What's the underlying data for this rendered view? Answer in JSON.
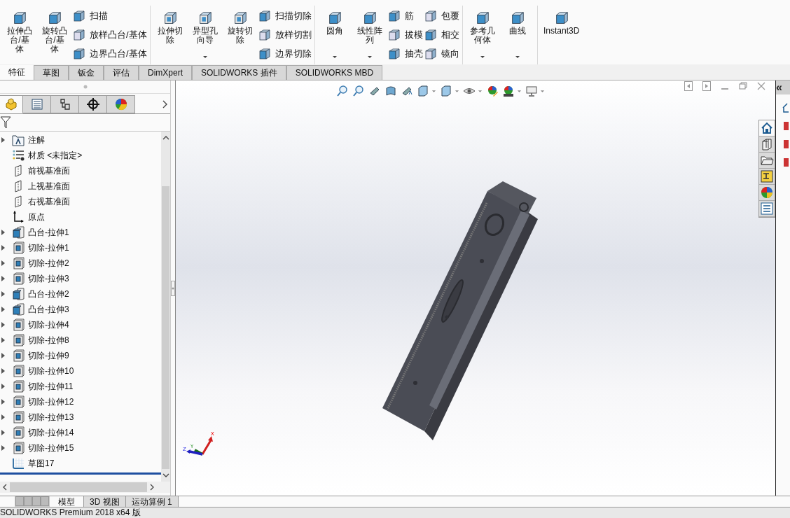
{
  "ribbon": {
    "groups": [
      {
        "large": [
          {
            "label": "拉伸凸台/基体",
            "dropdown": false
          },
          {
            "label": "旋转凸台/基体",
            "dropdown": false
          }
        ],
        "columns": [
          [
            "扫描",
            "放样凸台/基体",
            "边界凸台/基体"
          ]
        ]
      },
      {
        "large": [
          {
            "label": "拉伸切除",
            "dropdown": false
          },
          {
            "label": "异型孔向导",
            "dropdown": true
          },
          {
            "label": "旋转切除",
            "dropdown": false
          }
        ],
        "columns": [
          [
            "扫描切除",
            "放样切割",
            "边界切除"
          ]
        ]
      },
      {
        "large": [
          {
            "label": "圆角",
            "dropdown": true
          },
          {
            "label": "线性阵列",
            "dropdown": true
          }
        ],
        "columns": [
          [
            "筋",
            "拔模",
            "抽壳"
          ],
          [
            "包覆",
            "相交",
            "镜向"
          ]
        ]
      },
      {
        "large": [
          {
            "label": "参考几何体",
            "dropdown": true
          },
          {
            "label": "曲线",
            "dropdown": true
          }
        ]
      },
      {
        "large": [
          {
            "label": "Instant3D",
            "dropdown": false
          }
        ]
      }
    ]
  },
  "tabs": [
    {
      "label": "特征",
      "selected": true
    },
    {
      "label": "草图",
      "selected": false
    },
    {
      "label": "钣金",
      "selected": false
    },
    {
      "label": "评估",
      "selected": false
    },
    {
      "label": "DimXpert",
      "selected": false
    },
    {
      "label": "SOLIDWORKS 插件",
      "selected": false
    },
    {
      "label": "SOLIDWORKS MBD",
      "selected": false
    }
  ],
  "manager_tabs": [
    {
      "selected": true
    },
    {
      "selected": false
    },
    {
      "selected": false
    },
    {
      "selected": false
    },
    {
      "selected": false
    }
  ],
  "tree": [
    {
      "kind": "annotations",
      "label": "注解",
      "expandable": true
    },
    {
      "kind": "material",
      "label": "材质 <未指定>",
      "expandable": false
    },
    {
      "kind": "plane",
      "label": "前视基准面",
      "expandable": false
    },
    {
      "kind": "plane",
      "label": "上视基准面",
      "expandable": false
    },
    {
      "kind": "plane",
      "label": "右视基准面",
      "expandable": false
    },
    {
      "kind": "origin",
      "label": "原点",
      "expandable": false
    },
    {
      "kind": "boss",
      "label": "凸台-拉伸1",
      "expandable": true
    },
    {
      "kind": "cut",
      "label": "切除-拉伸1",
      "expandable": true
    },
    {
      "kind": "cut",
      "label": "切除-拉伸2",
      "expandable": true
    },
    {
      "kind": "cut",
      "label": "切除-拉伸3",
      "expandable": true
    },
    {
      "kind": "boss",
      "label": "凸台-拉伸2",
      "expandable": true
    },
    {
      "kind": "boss",
      "label": "凸台-拉伸3",
      "expandable": true
    },
    {
      "kind": "cut",
      "label": "切除-拉伸4",
      "expandable": true
    },
    {
      "kind": "cut",
      "label": "切除-拉伸8",
      "expandable": true
    },
    {
      "kind": "cut",
      "label": "切除-拉伸9",
      "expandable": true
    },
    {
      "kind": "cut",
      "label": "切除-拉伸10",
      "expandable": true
    },
    {
      "kind": "cut",
      "label": "切除-拉伸11",
      "expandable": true
    },
    {
      "kind": "cut",
      "label": "切除-拉伸12",
      "expandable": true
    },
    {
      "kind": "cut",
      "label": "切除-拉伸13",
      "expandable": true
    },
    {
      "kind": "cut",
      "label": "切除-拉伸14",
      "expandable": true
    },
    {
      "kind": "cut",
      "label": "切除-拉伸15",
      "expandable": true
    },
    {
      "kind": "sketch",
      "label": "草图17",
      "expandable": false
    }
  ],
  "triad": {
    "labels": [
      "X",
      "Y",
      "Z"
    ]
  },
  "bottom_tabs": [
    {
      "label": "模型",
      "selected": true
    },
    {
      "label": "3D 视图",
      "selected": false
    },
    {
      "label": "运动算例 1",
      "selected": false
    }
  ],
  "task_pane": {
    "collapse": "«"
  },
  "status_bar": {
    "text": "SOLIDWORKS Premium 2018 x64 版"
  }
}
